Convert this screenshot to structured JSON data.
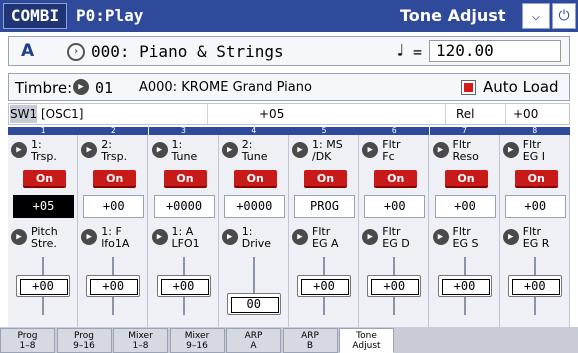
{
  "header": {
    "mode": "COMBI",
    "page": "P0:Play",
    "title": "Tone Adjust",
    "menu_icon": "chevron-down",
    "right_icon": "power-icon"
  },
  "combi": {
    "bank": "A",
    "name": "000: Piano & Strings",
    "note_glyph": "♩",
    "tempo_eq": "=",
    "tempo": "120.00"
  },
  "timbre": {
    "label": "Timbre:",
    "number": "01",
    "program": "A000: KROME Grand Piano",
    "auto_load_label": "Auto Load",
    "auto_load_checked": true
  },
  "switch": {
    "chip": "SW1",
    "osc": "[OSC1]",
    "value": "+05",
    "rel_label": "Rel",
    "rel_value": "+00"
  },
  "columns": [
    {
      "num": "1",
      "top_label": "1:\nTrsp.",
      "on": "On",
      "top_value": "+05",
      "selected": true,
      "bottom_label": "Pitch\nStre.",
      "slider_value": "+00",
      "slider_pos": 0.5
    },
    {
      "num": "2",
      "top_label": "2:\nTrsp.",
      "on": "On",
      "top_value": "+00",
      "selected": false,
      "bottom_label": "1: F\nlfo1A",
      "slider_value": "+00",
      "slider_pos": 0.5
    },
    {
      "num": "3",
      "top_label": "1:\nTune",
      "on": "On",
      "top_value": "+0000",
      "selected": false,
      "bottom_label": "1: A\nLFO1",
      "slider_value": "+00",
      "slider_pos": 0.5
    },
    {
      "num": "4",
      "top_label": "2:\nTune",
      "on": "On",
      "top_value": "+0000",
      "selected": false,
      "bottom_label": "1:\nDrive",
      "slider_value": "00",
      "slider_pos": 0.0
    },
    {
      "num": "5",
      "top_label": "1: MS\n/DK",
      "on": "On",
      "top_value": "PROG",
      "selected": false,
      "bottom_label": "Fltr\nEG A",
      "slider_value": "+00",
      "slider_pos": 0.5
    },
    {
      "num": "6",
      "top_label": "Fltr\nFc",
      "on": "On",
      "top_value": "+00",
      "selected": false,
      "bottom_label": "Fltr\nEG D",
      "slider_value": "+00",
      "slider_pos": 0.5
    },
    {
      "num": "7",
      "top_label": "Fltr\nReso",
      "on": "On",
      "top_value": "+00",
      "selected": false,
      "bottom_label": "Fltr\nEG S",
      "slider_value": "+00",
      "slider_pos": 0.5
    },
    {
      "num": "8",
      "top_label": "Fltr\nEG I",
      "on": "On",
      "top_value": "+00",
      "selected": false,
      "bottom_label": "Fltr\nEG R",
      "slider_value": "+00",
      "slider_pos": 0.5
    }
  ],
  "tabs": [
    {
      "label": "Prog\n1–8",
      "active": false
    },
    {
      "label": "Prog\n9–16",
      "active": false
    },
    {
      "label": "Mixer\n1–8",
      "active": false
    },
    {
      "label": "Mixer\n9–16",
      "active": false
    },
    {
      "label": "ARP\nA",
      "active": false
    },
    {
      "label": "ARP\nB",
      "active": false
    },
    {
      "label": "Tone\nAdjust",
      "active": true
    }
  ],
  "colors": {
    "accent_blue": "#2f4a9a",
    "on_red": "#c91a1a"
  }
}
